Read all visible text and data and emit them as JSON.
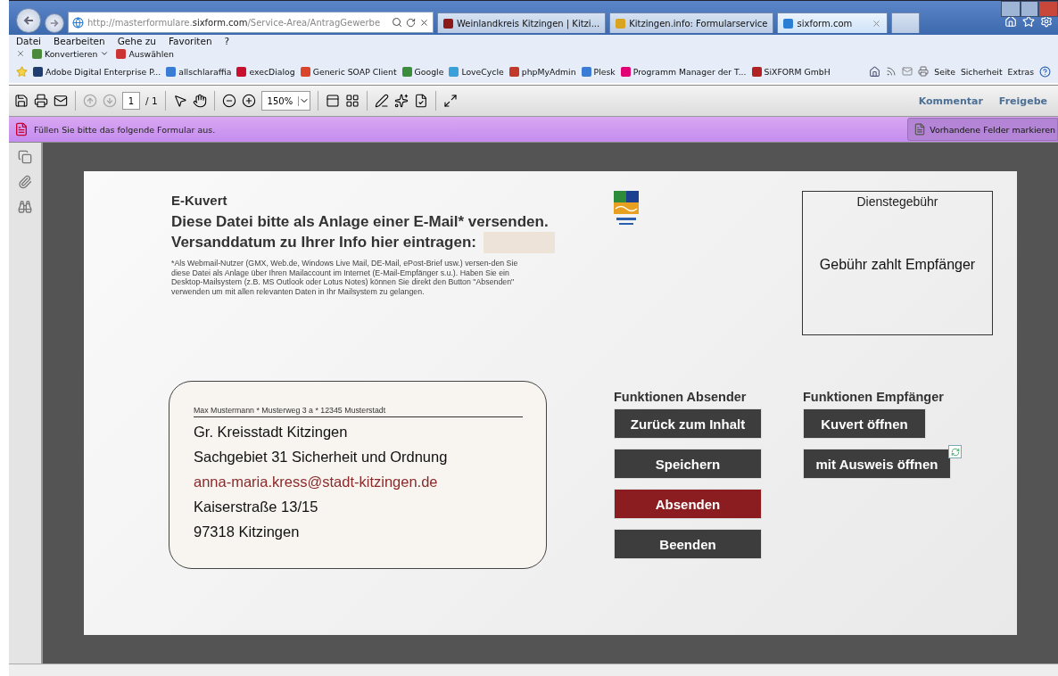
{
  "browser": {
    "address": "http://masterformulare.**sixform.com**/Service-Area/AntragGewerbe",
    "tabs": [
      {
        "title": "Weinlandkreis Kitzingen | Kitzi...",
        "selected": false
      },
      {
        "title": "Kitzingen.info: Formularservice",
        "selected": false
      },
      {
        "title": "sixform.com",
        "selected": true
      }
    ],
    "menu": [
      "Datei",
      "Bearbeiten",
      "Gehe zu",
      "Favoriten",
      "?"
    ],
    "commands": [
      "Konvertieren",
      "Auswählen"
    ],
    "favorites": [
      {
        "label": "Adobe Digital Enterprise P...",
        "color": "#1f3d6e"
      },
      {
        "label": "allschlaraffia",
        "color": "#3a7bd5"
      },
      {
        "label": "execDialog",
        "color": "#c8102e"
      },
      {
        "label": "Generic SOAP Client",
        "color": "#d9442b"
      },
      {
        "label": "Google",
        "color": "#3b8d3b"
      },
      {
        "label": "LoveCycle",
        "color": "#39a0d8"
      },
      {
        "label": "phpMyAdmin",
        "color": "#c0392b"
      },
      {
        "label": "Plesk",
        "color": "#3a7bd5"
      },
      {
        "label": "Programm Manager der T...",
        "color": "#e20074"
      },
      {
        "label": "SiXFORM GmbH",
        "color": "#b22222"
      }
    ],
    "tools": [
      "Seite",
      "Sicherheit",
      "Extras"
    ]
  },
  "viewer": {
    "page": "1",
    "pages": "/ 1",
    "zoom": "150%",
    "panels": [
      "Kommentar",
      "Freigebe"
    ],
    "notice": "Füllen Sie bitte das folgende Formular aus.",
    "highlight_button": "Vorhandene Felder markieren"
  },
  "form": {
    "title": "E-Kuvert",
    "heading": "Diese Datei bitte als Anlage einer E-Mail* versenden.",
    "date_label": "Versanddatum zu Ihrer Info hier eintragen:",
    "footnote": "*Als Webmail-Nutzer (GMX, Web.de, Windows Live Mail, DE-Mail, ePost-Brief usw.) versen-den Sie diese Datei als Anlage über Ihren Mailaccount im Internet (E-Mail-Empfänger s.u.). Haben Sie ein Desktop-Mailsystem (z.B. MS Outlook oder Lotus Notes) können Sie direkt den Button \"Absenden\" verwenden um mit allen relevanten Daten in Ihr Mailsystem zu gelangen.",
    "fee": {
      "title": "Dienstegebühr",
      "text": "Gebühr zahlt Empfänger"
    },
    "envelope": {
      "sender": "Max Mustermann  * Musterweg 3 a  * 12345  Musterstadt",
      "recipient": [
        {
          "kind": "text",
          "text": "Gr. Kreisstadt Kitzingen"
        },
        {
          "kind": "text",
          "text": "Sachgebiet 31 Sicherheit und Ordnung"
        },
        {
          "kind": "email",
          "text": "anna-maria.kress@stadt-kitzingen.de"
        },
        {
          "kind": "text",
          "text": "Kaiserstraße 13/15"
        },
        {
          "kind": "text",
          "text": "97318 Kitzingen"
        }
      ]
    },
    "sender_functions": {
      "title": "Funktionen Absender",
      "buttons": [
        {
          "label": "Zurück zum Inhalt",
          "kind": "normal"
        },
        {
          "label": "Speichern",
          "kind": "normal"
        },
        {
          "label": "Absenden",
          "kind": "primary"
        },
        {
          "label": "Beenden",
          "kind": "normal"
        }
      ]
    },
    "recipient_functions": {
      "title": "Funktionen Empfänger",
      "buttons": [
        {
          "label": "Kuvert öffnen"
        },
        {
          "label": "mit Ausweis öffnen"
        }
      ]
    }
  }
}
